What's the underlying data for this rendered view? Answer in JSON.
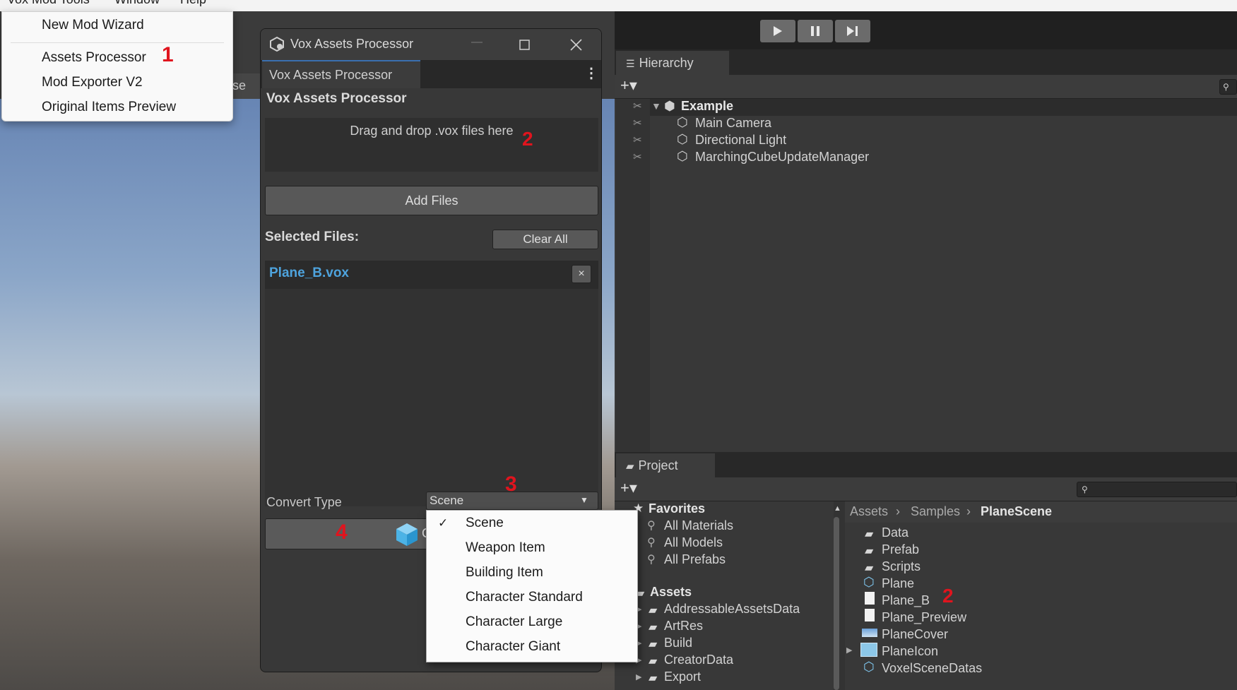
{
  "menubar": {
    "items": [
      "Vox Mod Tools",
      "Window",
      "Help"
    ]
  },
  "tools_menu": {
    "items": [
      "New Mod Wizard",
      "Assets Processor",
      "Mod Exporter V2",
      "Original Items Preview"
    ],
    "marker": "1"
  },
  "scene": {
    "partial_tab": "cuse"
  },
  "playbar": {
    "play_icon": "play-icon",
    "pause_icon": "pause-icon",
    "step_icon": "step-icon"
  },
  "window": {
    "title": "Vox Assets Processor",
    "tab": "Vox Assets Processor",
    "header": "Vox Assets Processor",
    "dropzone_text": "Drag and drop .vox files here",
    "dropzone_marker": "2",
    "add_files": "Add Files",
    "selected_files_label": "Selected Files:",
    "clear_all": "Clear All",
    "files": [
      "Plane_B.vox"
    ],
    "remove_glyph": "×",
    "convert_type_label": "Convert Type",
    "convert_type_value": "Scene",
    "convert_marker": "3",
    "convert_button_marker": "4",
    "convert_button_partial": "C"
  },
  "convert_options": {
    "selected": "Scene",
    "items": [
      "Scene",
      "Weapon Item",
      "Building Item",
      "Character Standard",
      "Character Large",
      "Character Giant"
    ]
  },
  "hierarchy": {
    "tab": "Hierarchy",
    "root": "Example",
    "items": [
      "Main Camera",
      "Directional Light",
      "MarchingCubeUpdateManager"
    ]
  },
  "project": {
    "tab": "Project",
    "favorites_label": "Favorites",
    "favorites": [
      "All Materials",
      "All Models",
      "All Prefabs"
    ],
    "assets_label": "Assets",
    "asset_folders": [
      "AddressableAssetsData",
      "ArtRes",
      "Build",
      "CreatorData",
      "Export"
    ],
    "breadcrumb": [
      "Assets",
      "Samples",
      "PlaneScene"
    ],
    "contents": [
      "Data",
      "Prefab",
      "Scripts",
      "Plane",
      "Plane_B",
      "Plane_Preview",
      "PlaneCover",
      "PlaneIcon",
      "VoxelSceneDatas"
    ],
    "plane_b_marker": "2"
  },
  "colors": {
    "accent_file": "#4ea3dd",
    "marker_red": "#e0141e",
    "panel": "#383838"
  }
}
